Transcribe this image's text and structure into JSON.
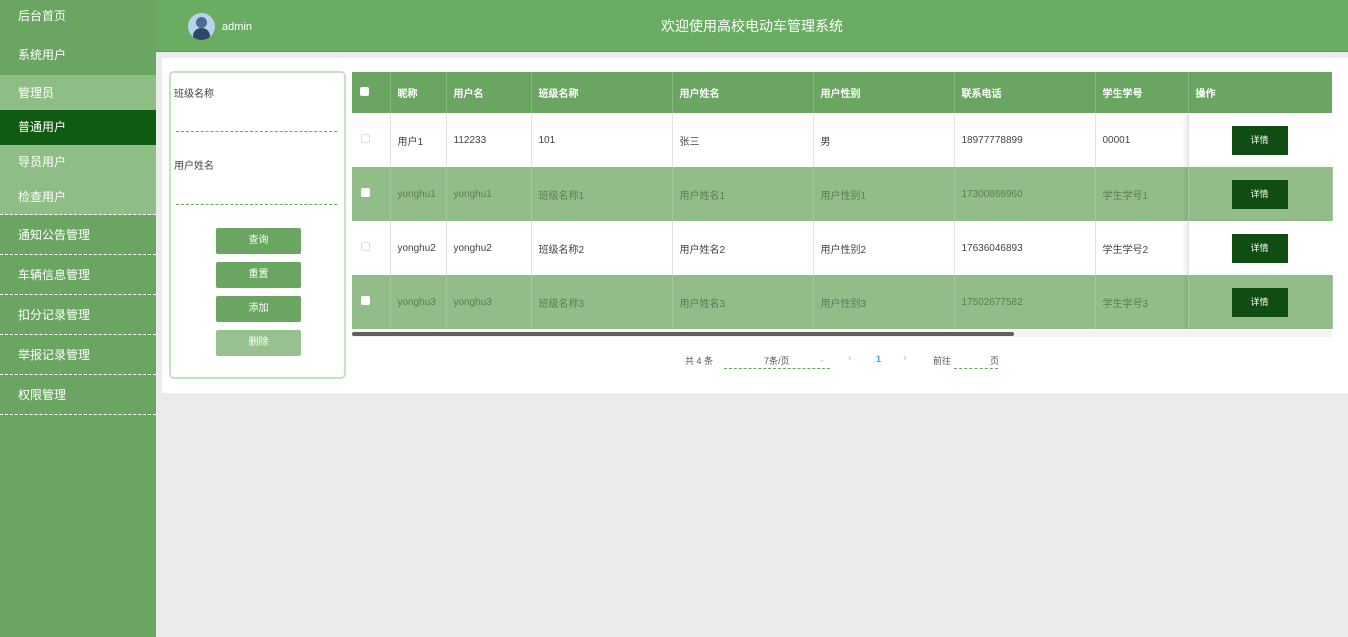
{
  "sidebar": {
    "items": [
      {
        "label": "后台首页"
      },
      {
        "label": "系统用户"
      },
      {
        "label": "管理员"
      },
      {
        "label": "普通用户"
      },
      {
        "label": "导员用户"
      },
      {
        "label": "检查用户"
      },
      {
        "label": "通知公告管理"
      },
      {
        "label": "车辆信息管理"
      },
      {
        "label": "扣分记录管理"
      },
      {
        "label": "举报记录管理"
      },
      {
        "label": "权限管理"
      }
    ]
  },
  "header": {
    "user": "admin",
    "title": "欢迎使用高校电动车管理系统",
    "avatar_icon": "user-avatar-icon"
  },
  "search": {
    "class_label": "班级名称",
    "class_value": "",
    "name_label": "用户姓名",
    "name_value": "",
    "query_label": "查询",
    "reset_label": "重置",
    "add_label": "添加",
    "delete_label": "删除"
  },
  "table": {
    "headers": [
      "昵称",
      "用户名",
      "班级名称",
      "用户姓名",
      "用户性别",
      "联系电话",
      "学生学号",
      "操作"
    ],
    "rows": [
      {
        "nickname": "用户1",
        "username": "112233",
        "class": "101",
        "name": "张三",
        "gender": "男",
        "phone": "18977778899",
        "student_no": "00001",
        "action": "详情"
      },
      {
        "nickname": "yonghu1",
        "username": "yonghu1",
        "class": "班级名称1",
        "name": "用户姓名1",
        "gender": "用户性别1",
        "phone": "17300866960",
        "student_no": "学生学号1",
        "action": "详情"
      },
      {
        "nickname": "yonghu2",
        "username": "yonghu2",
        "class": "班级名称2",
        "name": "用户姓名2",
        "gender": "用户性别2",
        "phone": "17636046893",
        "student_no": "学生学号2",
        "action": "详情"
      },
      {
        "nickname": "yonghu3",
        "username": "yonghu3",
        "class": "班级名称3",
        "name": "用户姓名3",
        "gender": "用户性别3",
        "phone": "17502677582",
        "student_no": "学生学号3",
        "action": "详情"
      }
    ]
  },
  "pagination": {
    "total": "共 4 条",
    "page_size": "7条/页",
    "current_page": "1",
    "goto_label": "前往",
    "page_unit": "页",
    "prev_icon": "‹",
    "next_icon": "›",
    "dropdown_icon": "⌄"
  },
  "colors": {
    "primary": "#6aa562",
    "active": "#0f5b12",
    "detail_button": "#104d12",
    "stripe": "#92bd89"
  }
}
